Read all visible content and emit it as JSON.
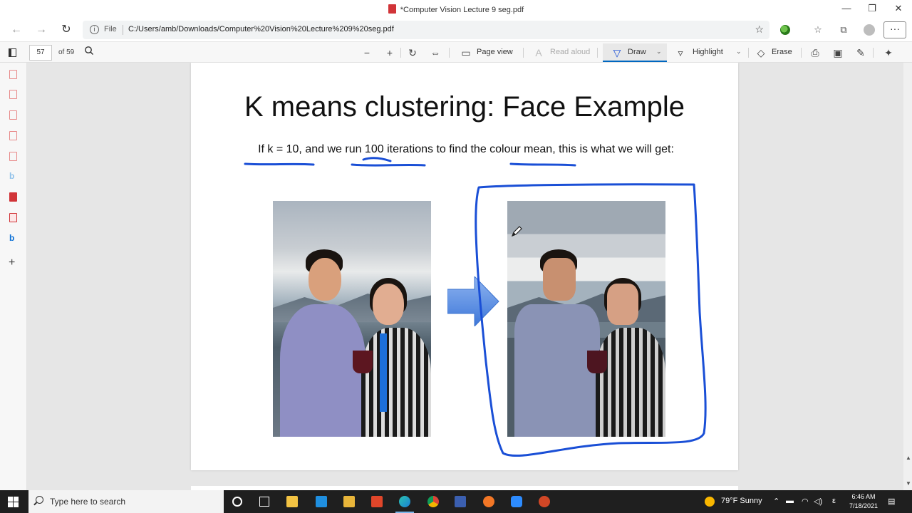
{
  "window": {
    "title": "*Computer Vision Lecture 9 seg.pdf",
    "minimize_label": "—",
    "restore_label": "❐",
    "close_label": "✕"
  },
  "address_bar": {
    "scheme_label": "File",
    "url": "C:/Users/amb/Downloads/Computer%20Vision%20Lecture%209%20seg.pdf"
  },
  "pdf_toolbar": {
    "page_number": "57",
    "page_count": "of 59",
    "page_view_label": "Page view",
    "read_aloud_label": "Read aloud",
    "draw_label": "Draw",
    "highlight_label": "Highlight",
    "erase_label": "Erase"
  },
  "slide": {
    "title": "K means clustering: Face Example",
    "subtitle": "If k = 10, and we run 100 iterations to find the colour mean, this is what we will get:"
  },
  "annotation": {
    "ink_color": "#1a4fd6"
  },
  "taskbar": {
    "search_placeholder": "Type here to search",
    "weather": "79°F  Sunny",
    "ime_indicator": "ε",
    "time": "6:46 AM",
    "date": "7/18/2021"
  },
  "colors": {
    "accent": "#0067c0",
    "pdf_red": "#d13438",
    "taskbar": "#1f1f1f"
  }
}
